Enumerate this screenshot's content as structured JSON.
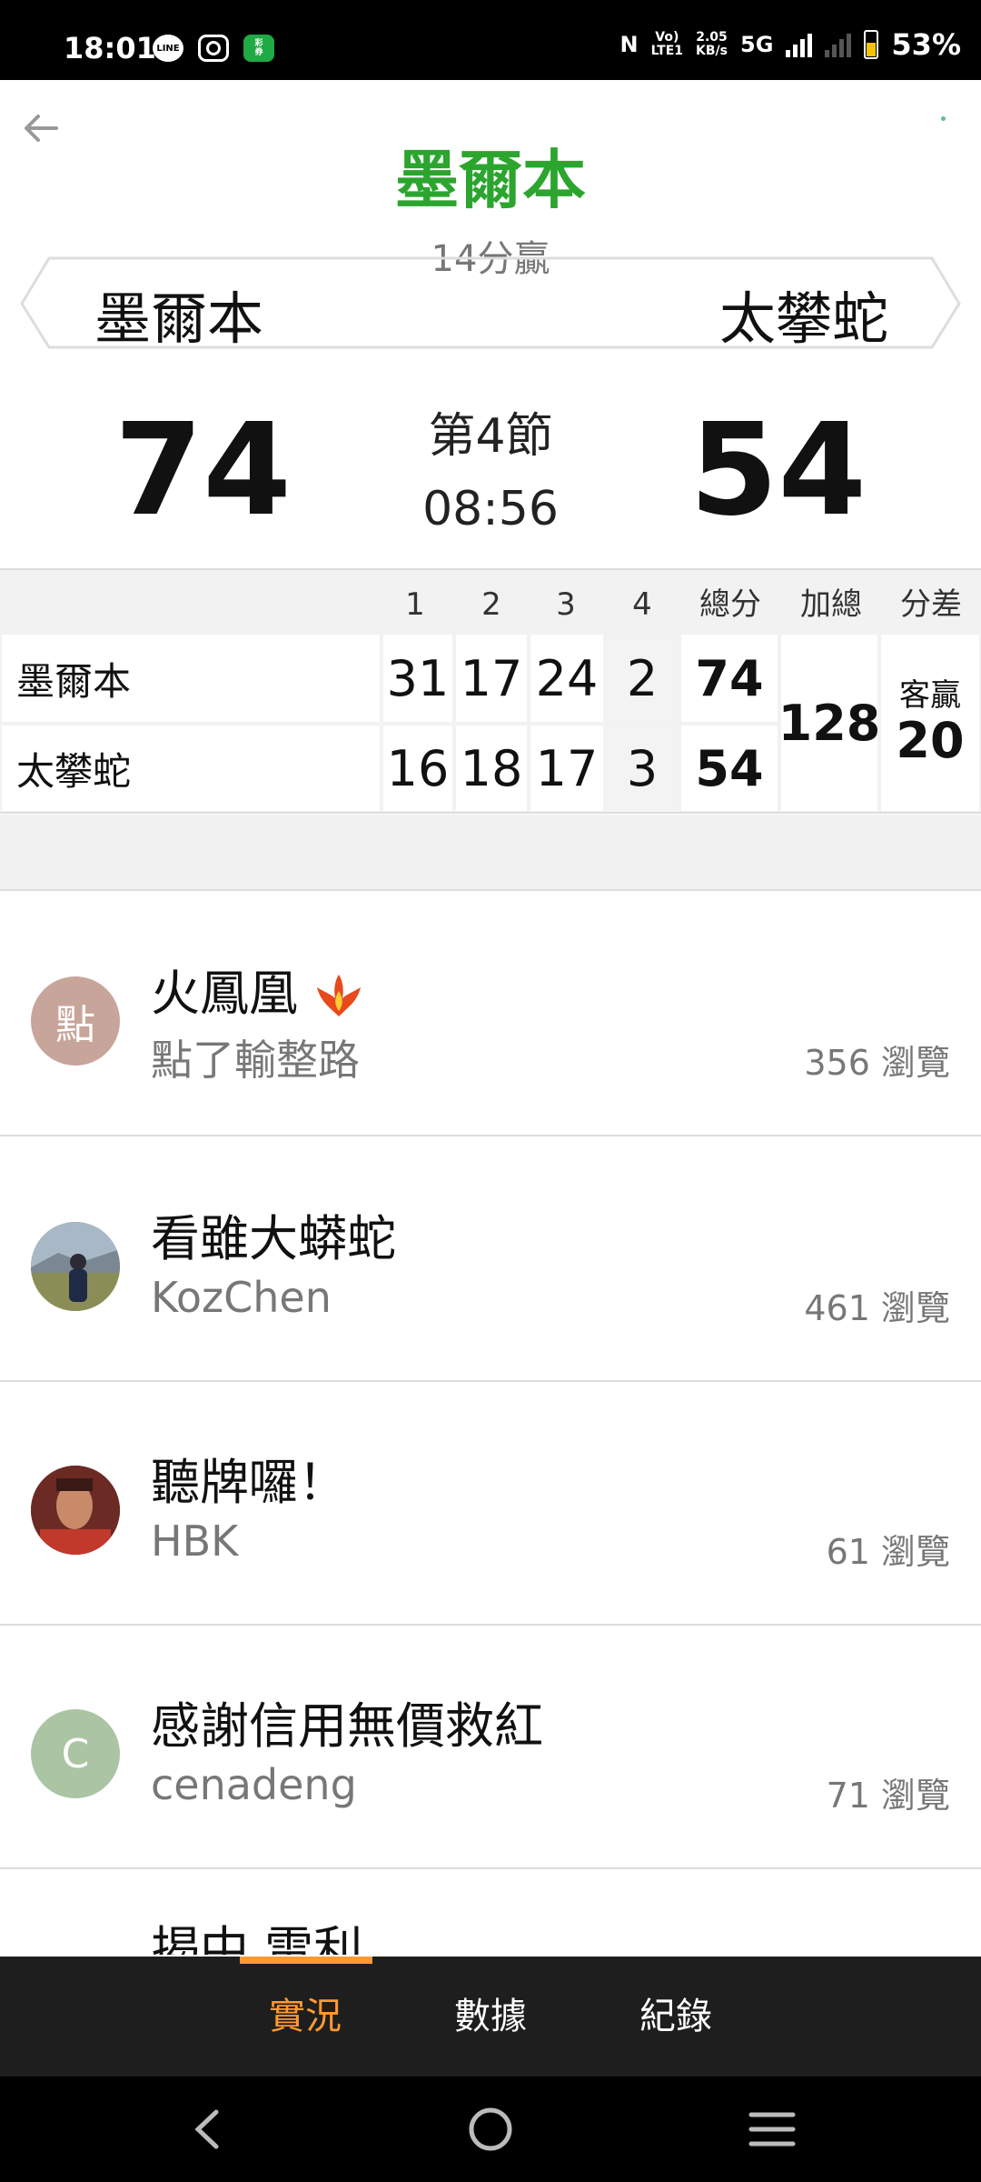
{
  "status_bar": {
    "time": "18:01",
    "data_rate": "2.05\nKB/s",
    "network": "5G",
    "lte": "Vo)\nLTE1",
    "battery": "53%"
  },
  "game": {
    "leader_title": "墨爾本",
    "margin_text": "14分贏",
    "home_team": "墨爾本",
    "away_team": "太攀蛇",
    "home_score": "74",
    "away_score": "54",
    "period": "第4節",
    "clock": "08:56"
  },
  "box_score": {
    "headers": [
      "1",
      "2",
      "3",
      "4",
      "總分",
      "加總",
      "分差"
    ],
    "rows": [
      {
        "team": "墨爾本",
        "q": [
          "31",
          "17",
          "24",
          "2"
        ],
        "total": "74"
      },
      {
        "team": "太攀蛇",
        "q": [
          "16",
          "18",
          "17",
          "3"
        ],
        "total": "54"
      }
    ],
    "combined": "128",
    "diff_label": "客贏",
    "diff_value": "20"
  },
  "posts": [
    {
      "title": "火鳳凰",
      "author": "點了輸整路",
      "views": "356 瀏覽",
      "avatar_text": "點",
      "avatar_color": "#c8a59a"
    },
    {
      "title": "看雖大蟒蛇",
      "author": "KozChen",
      "views": "461 瀏覽",
      "avatar_text": "",
      "avatar_color": "#7d8f6a"
    },
    {
      "title": "聽牌囉！",
      "author": "HBK",
      "views": "61 瀏覽",
      "avatar_text": "",
      "avatar_color": "#8a3a30"
    },
    {
      "title": "感謝信用無價救紅",
      "author": "cenadeng",
      "views": "71 瀏覽",
      "avatar_text": "C",
      "avatar_color": "#aac4a4"
    }
  ],
  "partial_post_title": "揭中 雷利",
  "tabs": [
    "實況",
    "數據",
    "紀錄"
  ],
  "colors": {
    "accent_green": "#2ca52f",
    "accent_orange": "#ff9933",
    "tabbar_bg": "#1e1e1e"
  }
}
